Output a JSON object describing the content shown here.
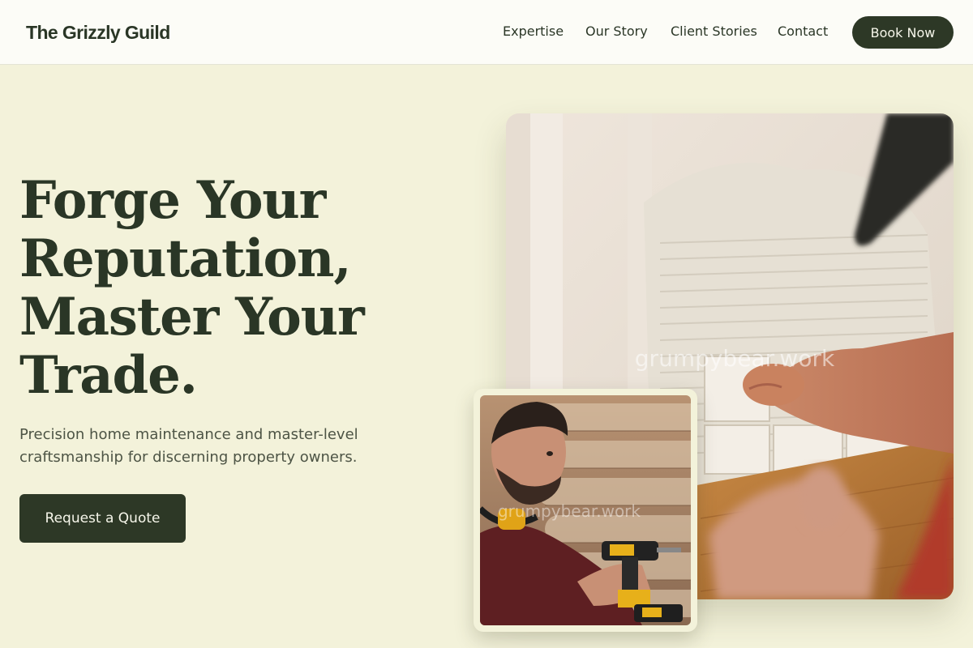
{
  "header": {
    "brand": "The Grizzly Guild",
    "nav": [
      "Expertise",
      "Our Story",
      "Client Stories",
      "Contact"
    ],
    "book_label": "Book Now"
  },
  "hero": {
    "title_lines": [
      "Forge Your",
      "Reputation,",
      "Master Your",
      "Trade."
    ],
    "subtitle": "Precision home maintenance and master-level craftsmanship for discerning property owners.",
    "cta_label": "Request a Quote"
  },
  "images": {
    "main_watermark": "grumpybear.work",
    "inset_watermark": "grumpybear.work"
  },
  "colors": {
    "background": "#f3f2da",
    "header_bg": "#fcfcf7",
    "primary_dark": "#2d3826",
    "button_text": "#f6f6ea"
  }
}
